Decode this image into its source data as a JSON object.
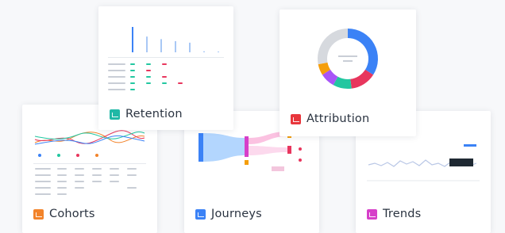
{
  "cards": {
    "retention": {
      "label": "Retention",
      "icon": "retention-icon",
      "color": "#1fb8a6"
    },
    "attribution": {
      "label": "Attribution",
      "icon": "attribution-icon",
      "color": "#e8363c"
    },
    "cohorts": {
      "label": "Cohorts",
      "icon": "cohorts-icon",
      "color": "#f2832a"
    },
    "journeys": {
      "label": "Journeys",
      "icon": "journeys-icon",
      "color": "#3b82f6"
    },
    "trends": {
      "label": "Trends",
      "icon": "trends-icon",
      "color": "#d63fc9"
    }
  },
  "donut": {
    "segments": [
      {
        "color": "#3b82f6",
        "value": 34
      },
      {
        "color": "#e8365d",
        "value": 14
      },
      {
        "color": "#22c7a0",
        "value": 10
      },
      {
        "color": "#a855f7",
        "value": 8
      },
      {
        "color": "#f59e0b",
        "value": 6
      },
      {
        "color": "#d6d9de",
        "value": 28
      }
    ]
  },
  "retention_bars": [
    100,
    62,
    52,
    44,
    38,
    4,
    3
  ]
}
